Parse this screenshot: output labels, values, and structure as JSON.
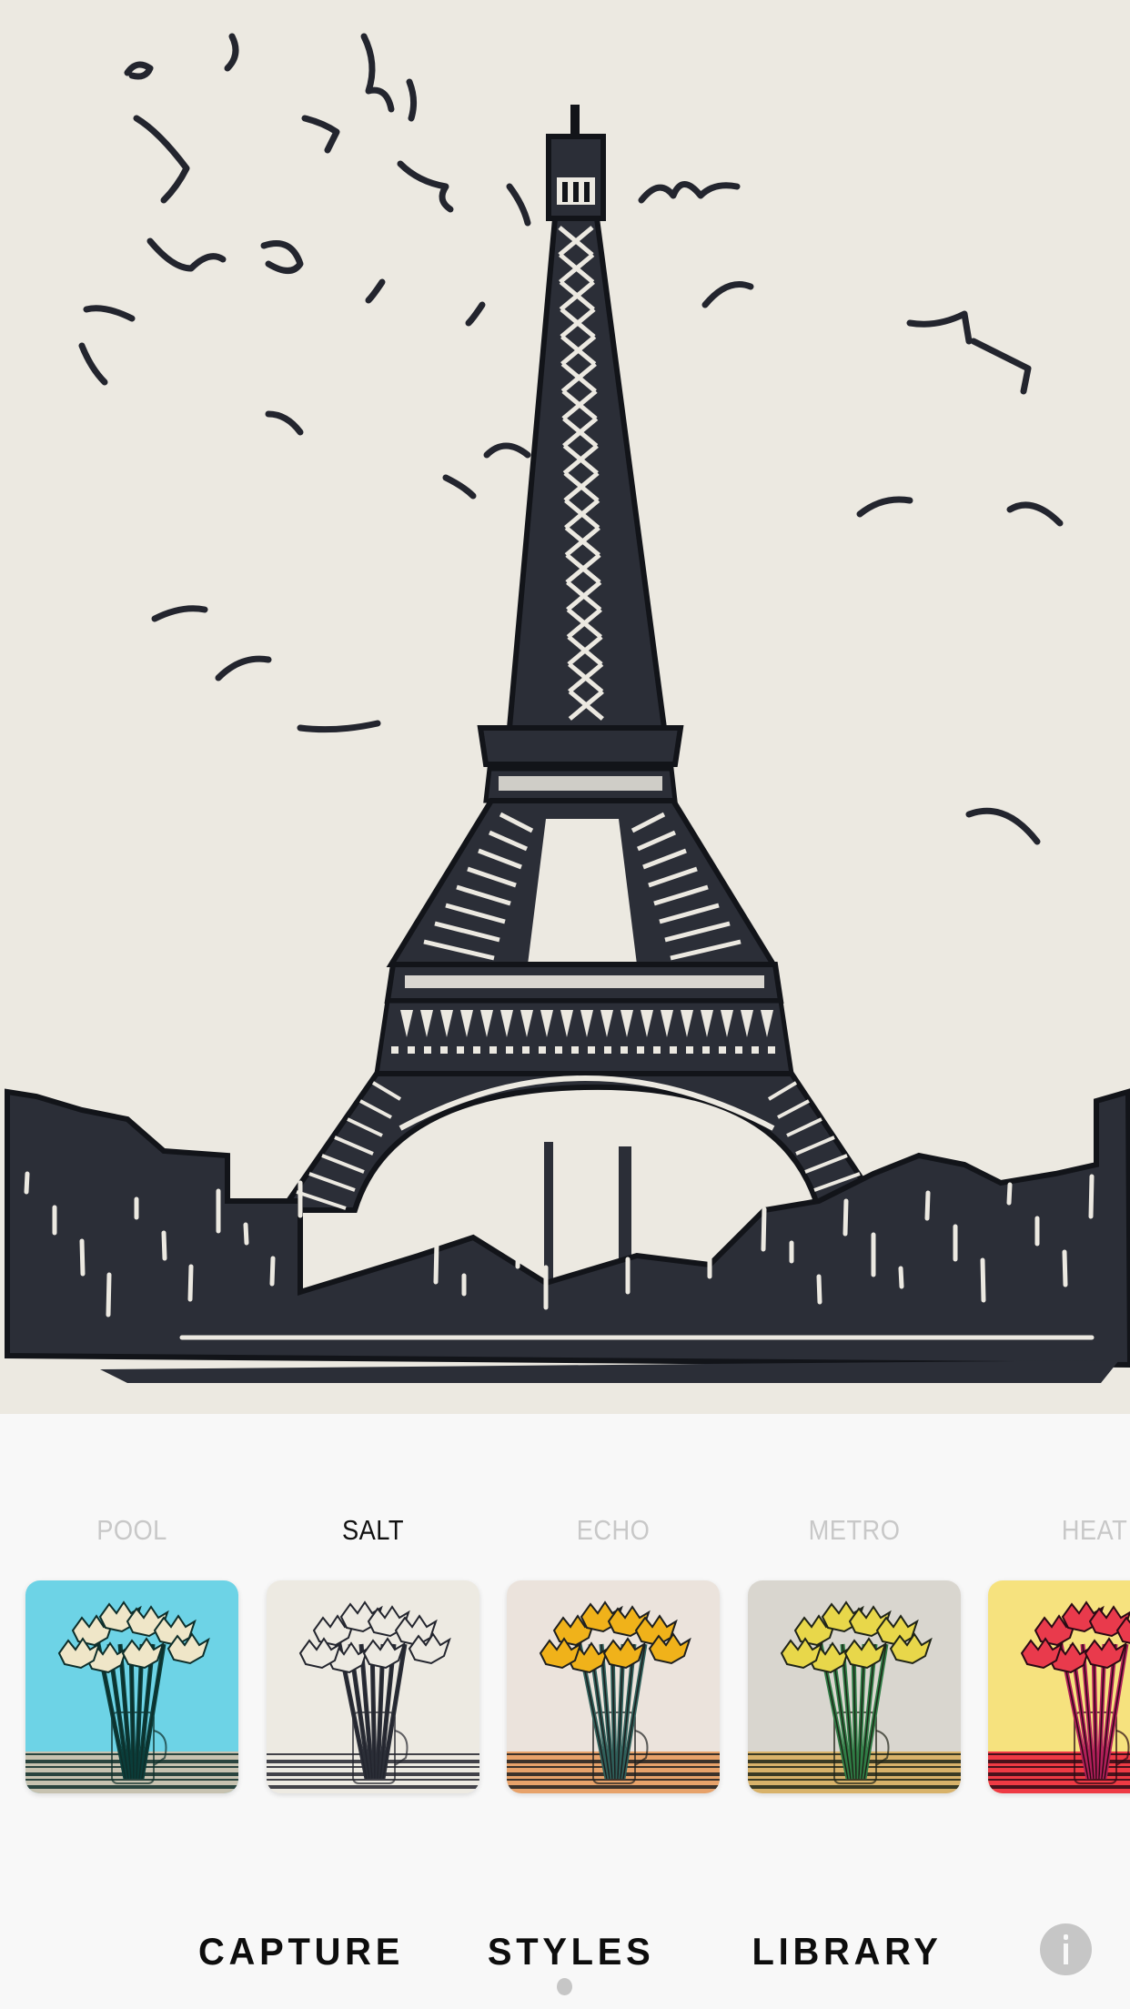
{
  "artwork": {
    "subject": "Eiffel Tower with birds and trees",
    "applied_style": "SALT",
    "colors": {
      "background": "#ece9e1",
      "ink": "#2b2e37",
      "ink_dark": "#121419"
    }
  },
  "styles": {
    "selected": "SALT",
    "items": [
      {
        "label": "POOL",
        "bg": "#6dd3e6",
        "ink": "#0e2e2a",
        "flower": "#efe6c8",
        "stem": "#0b3d3a",
        "table": "#c7c2b0"
      },
      {
        "label": "SALT",
        "bg": "#edeae2",
        "ink": "#23252e",
        "flower": "#edeae2",
        "stem": "#2b2e37",
        "table": "#edeae2"
      },
      {
        "label": "ECHO",
        "bg": "#ebe3dc",
        "ink": "#1d1f1f",
        "flower": "#f0b21a",
        "stem": "#2f5f5a",
        "table": "#e7a26a"
      },
      {
        "label": "METRO",
        "bg": "#d9d6cf",
        "ink": "#1f2418",
        "flower": "#e8d74a",
        "stem": "#2f7c45",
        "table": "#d8b26a"
      },
      {
        "label": "HEAT",
        "bg": "#f6e27e",
        "ink": "#2a0a14",
        "flower": "#e93a4c",
        "stem": "#b01f5a",
        "table": "#ee3a44"
      }
    ]
  },
  "nav": {
    "capture": "CAPTURE",
    "styles": "STYLES",
    "library": "LIBRARY",
    "active": "STYLES"
  },
  "info_button": {
    "icon": "info-icon"
  }
}
